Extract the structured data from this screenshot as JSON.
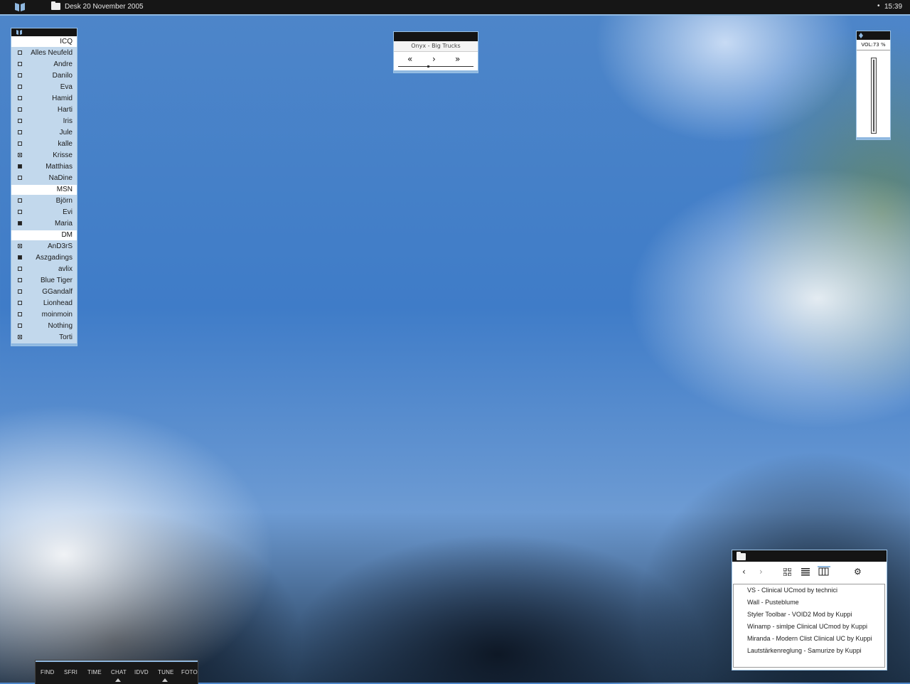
{
  "taskbar": {
    "desk_label": "Desk 20 November 2005",
    "dot": "•",
    "clock": "15:39"
  },
  "contacts": {
    "groups": [
      {
        "name": "ICQ",
        "contacts": [
          {
            "name": "Alles Neufeld",
            "status": "offline"
          },
          {
            "name": "Andre",
            "status": "offline"
          },
          {
            "name": "Danilo",
            "status": "offline"
          },
          {
            "name": "Eva",
            "status": "offline"
          },
          {
            "name": "Hamid",
            "status": "offline"
          },
          {
            "name": "Harti",
            "status": "offline"
          },
          {
            "name": "Iris",
            "status": "offline"
          },
          {
            "name": "Jule",
            "status": "offline"
          },
          {
            "name": "kalle",
            "status": "offline"
          },
          {
            "name": "Krisse",
            "status": "away"
          },
          {
            "name": "Matthias",
            "status": "online"
          },
          {
            "name": "NaDine",
            "status": "offline"
          }
        ]
      },
      {
        "name": "MSN",
        "contacts": [
          {
            "name": "Björn",
            "status": "offline"
          },
          {
            "name": "Evi",
            "status": "offline"
          },
          {
            "name": "Maria",
            "status": "online"
          }
        ]
      },
      {
        "name": "DM",
        "contacts": [
          {
            "name": "AnD3rS",
            "status": "away"
          },
          {
            "name": "Aszgadings",
            "status": "online"
          },
          {
            "name": "avlix",
            "status": "offline"
          },
          {
            "name": "Blue Tiger",
            "status": "offline"
          },
          {
            "name": "GGandalf",
            "status": "offline"
          },
          {
            "name": "Lionhead",
            "status": "offline"
          },
          {
            "name": "moinmoin",
            "status": "offline"
          },
          {
            "name": "Nothing",
            "status": "offline"
          },
          {
            "name": "Torti",
            "status": "away"
          }
        ]
      }
    ]
  },
  "player": {
    "track": "Onyx - Big Trucks",
    "prev_glyph": "«",
    "play_glyph": "›",
    "next_glyph": "»",
    "progress_fraction": 0.4
  },
  "volume": {
    "label": "VOL:73 %",
    "level_percent": 73
  },
  "explorer": {
    "back_glyph": "‹",
    "forward_glyph": "›",
    "settings_glyph": "⚙",
    "items": [
      "VS - Clinical UCmod by technici",
      "Wall - Pusteblume",
      "Styler Toolbar - VOID2 Mod by Kuppi",
      "Winamp - simlpe Clinical UCmod by Kuppi",
      "Miranda - Modern Clist Clinical UC by Kuppi",
      "Lautstärkenreglung - Samurize by Kuppi"
    ]
  },
  "launcher": {
    "items": [
      "FIND",
      "SFRI",
      "TIME",
      "CHAT",
      "IDVD",
      "TUNE",
      "FOTO"
    ]
  },
  "colors": {
    "accent": "#8fb8e0",
    "bar_bg": "#161616",
    "list_bg": "#c2d8ec"
  }
}
